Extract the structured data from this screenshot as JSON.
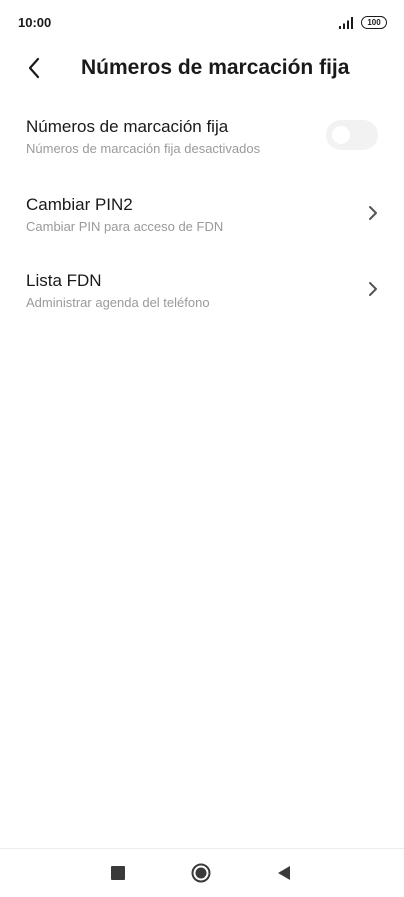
{
  "status_bar": {
    "time": "10:00",
    "battery": "100",
    "signal_icon": "signal-bars-icon",
    "battery_icon": "battery-icon"
  },
  "header": {
    "title": "Números de marcación fija",
    "back_icon": "chevron-left-icon"
  },
  "settings": {
    "fdn_toggle": {
      "title": "Números de marcación fija",
      "subtitle": "Números de marcación fija desactivados",
      "enabled": false
    },
    "change_pin2": {
      "title": "Cambiar PIN2",
      "subtitle": "Cambiar PIN para acceso de FDN",
      "icon": "chevron-right-icon"
    },
    "fdn_list": {
      "title": "Lista FDN",
      "subtitle": "Administrar agenda del teléfono",
      "icon": "chevron-right-icon"
    }
  },
  "nav_bar": {
    "recents_icon": "square-icon",
    "home_icon": "circle-icon",
    "back_icon": "triangle-back-icon"
  },
  "colors": {
    "text_primary": "#1a1a1a",
    "text_secondary": "#9a9a9a",
    "toggle_off": "#f2f2f2",
    "nav_icon": "#3a3a3a"
  }
}
